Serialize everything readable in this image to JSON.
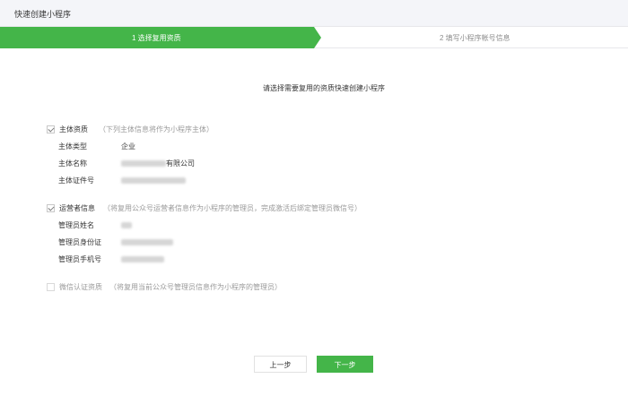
{
  "window": {
    "title": "快速创建小程序"
  },
  "steps": [
    {
      "label": "1 选择复用资质",
      "active": true
    },
    {
      "label": "2 填写小程序帐号信息",
      "active": false
    }
  ],
  "instruction": "请选择需要复用的资质快速创建小程序",
  "sections": {
    "subject": {
      "label": "主体资质",
      "note": "（下列主体信息将作为小程序主体）",
      "checked": true,
      "fields": [
        {
          "label": "主体类型",
          "value": "企业"
        },
        {
          "label": "主体名称",
          "value_suffix": "有限公司"
        },
        {
          "label": "主体证件号"
        }
      ]
    },
    "operator": {
      "label": "运营者信息",
      "note": "（将复用公众号运营者信息作为小程序的管理员，完成激活后绑定管理员微信号）",
      "checked": true,
      "fields": [
        {
          "label": "管理员姓名"
        },
        {
          "label": "管理员身份证"
        },
        {
          "label": "管理员手机号"
        }
      ]
    },
    "wechat_cert": {
      "label": "微信认证资质",
      "note": "（将复用当前公众号管理员信息作为小程序的管理员）",
      "checked": false
    }
  },
  "buttons": {
    "prev": "上一步",
    "next": "下一步"
  },
  "colors": {
    "accent": "#44b549",
    "muted": "#9a9a9a"
  }
}
